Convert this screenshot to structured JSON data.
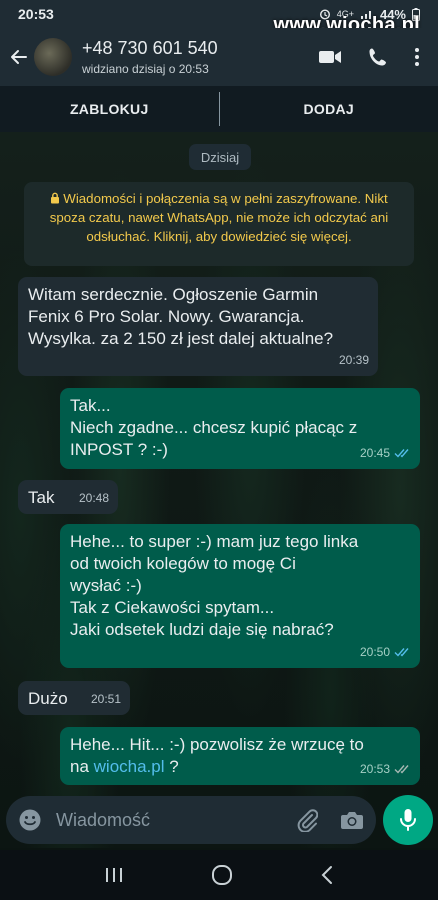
{
  "status_bar": {
    "time": "20:53",
    "network": "4G+",
    "battery": "44%",
    "watermark": "www.wiocha.pl"
  },
  "header": {
    "contact_name": "+48 730 601 540",
    "last_seen": "widziano dzisiaj o 20:53",
    "icons": [
      "back-arrow-icon",
      "video-call-icon",
      "phone-icon",
      "more-vert-icon"
    ]
  },
  "actions": {
    "block": "ZABLOKUJ",
    "add": "DODAJ"
  },
  "chat": {
    "date_chip": "Dzisiaj",
    "encryption_notice": "Wiadomości i połączenia są w pełni zaszyfrowane. Nikt spoza czatu, nawet WhatsApp, nie może ich odczytać ani odsłuchać. Kliknij, aby dowiedzieć się więcej.",
    "messages": [
      {
        "dir": "in",
        "text": "Witam serdecznie. Ogłoszenie Garmin\nFenix 6 Pro Solar. Nowy. Gwarancja.\nWysylka. za 2 150 zł jest dalej aktualne?",
        "time": "20:39"
      },
      {
        "dir": "out",
        "text": "Tak...\nNiech zgadne... chcesz kupić płacąc z\nINPOST ? :-)",
        "time": "20:45",
        "status": "read"
      },
      {
        "dir": "in",
        "text": "Tak",
        "time": "20:48"
      },
      {
        "dir": "out",
        "text": "Hehe... to super :-) mam juz tego linka\nod twoich kolegów to mogę Ci\nwysłać :-)\nTak z Ciekawości spytam...\nJaki odsetek ludzi daje się nabrać?",
        "time": "20:50",
        "status": "read"
      },
      {
        "dir": "in",
        "text": "Dużo",
        "time": "20:51"
      },
      {
        "dir": "out",
        "text_before": "Hehe... Hit... :-) pozwolisz że wrzucę to\nna ",
        "link": "wiocha.pl",
        "text_after": " ?",
        "time": "20:53",
        "status": "delivered"
      }
    ]
  },
  "composer": {
    "placeholder": "Wiadomość"
  },
  "colors": {
    "accent": "#00a884",
    "outgoing_bubble": "#005c4b",
    "incoming_bubble": "#202c33",
    "read_ticks": "#53bdeb",
    "encryption_text": "#f2c94c"
  }
}
